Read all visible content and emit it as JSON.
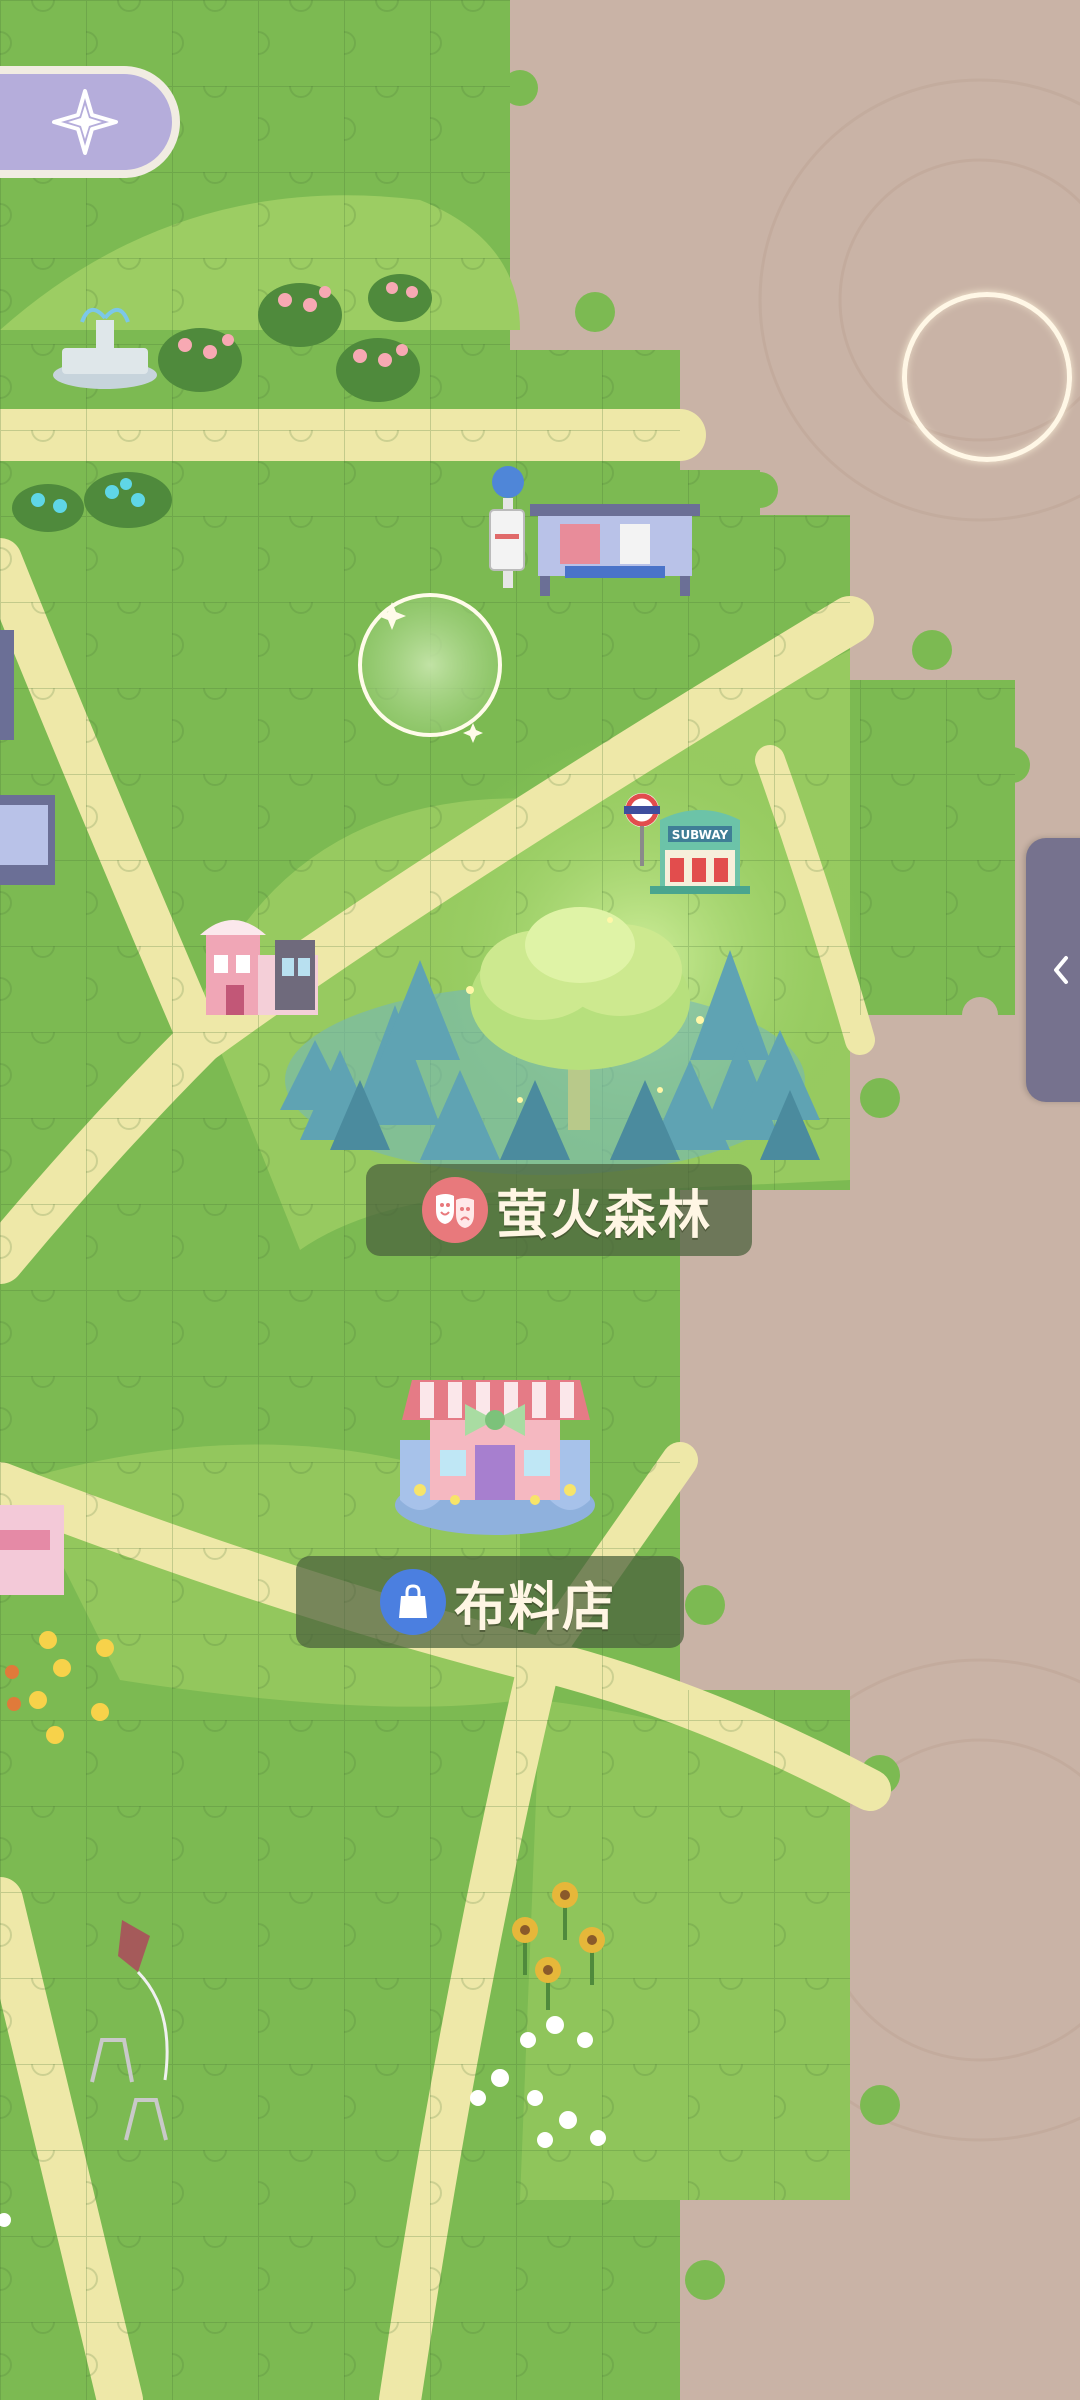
{
  "map": {
    "locations": [
      {
        "id": "forest",
        "name": "萤火森林",
        "icon": "theater-masks-icon"
      },
      {
        "id": "fabric_shop",
        "name": "布料店",
        "icon": "shopping-bag-icon"
      }
    ],
    "subway_sign": "SUBWAY"
  },
  "controls": {
    "compass_icon": "compass-navigation-icon",
    "side_tab_icon": "chevron-left-icon"
  },
  "colors": {
    "grass": "#7cba52",
    "grass_light": "#9ccd63",
    "path": "#eee8a8",
    "ground": "#c9b3a6",
    "accent_purple": "#b5addb",
    "label_bg": "#4a603c"
  }
}
